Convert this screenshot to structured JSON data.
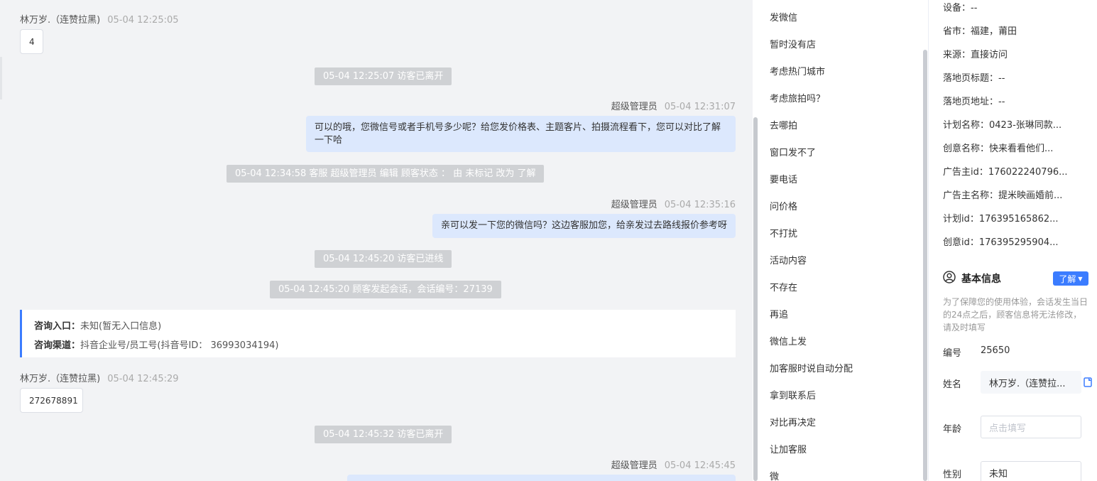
{
  "chat": {
    "messages": [
      {
        "sender": "林万岁.（连赞拉黑)",
        "time": "05-04 12:25:05",
        "text": "4"
      },
      {
        "system": "05-04 12:25:07 访客已离开"
      },
      {
        "sender": "超级管理员",
        "time": "05-04 12:31:07",
        "text": "可以的哦，您微信号或者手机号多少呢？给您发价格表、主题客片、拍摄流程看下，您可以对比了解一下哈"
      },
      {
        "system": "05-04 12:34:58 客服 超级管理员 编辑 顾客状态 ： 由 未标记 改为 了解"
      },
      {
        "sender": "超级管理员",
        "time": "05-04 12:35:16",
        "text": "亲可以发一下您的微信吗？这边客服加您，给亲发过去路线报价参考呀"
      },
      {
        "system": "05-04 12:45:20 访客已进线"
      },
      {
        "system": "05-04 12:45:20 顾客发起会话，会话编号：27139"
      },
      {
        "sender": "林万岁.（连赞拉黑)",
        "time": "05-04 12:45:29",
        "text": "272678891"
      },
      {
        "system": "05-04 12:45:32 访客已离开"
      },
      {
        "sender": "超级管理员",
        "time": "05-04 12:45:45"
      }
    ],
    "consult": {
      "entry_label": "咨询入口：",
      "entry_value": "未知(暂无入口信息)",
      "channel_label": "咨询渠道：",
      "channel_value": "抖音企业号/员工号(抖音号ID： 36993034194)"
    }
  },
  "quick_replies": [
    "发微信",
    "暂时没有店",
    "考虑热门城市",
    "考虑旅拍吗？",
    "去哪拍",
    "窗口发不了",
    "要电话",
    "问价格",
    "不打扰",
    "活动内容",
    "不存在",
    "再追",
    "微信上发",
    "加客服时说自动分配",
    "拿到联系后",
    "对比再决定",
    "让加客服",
    "微"
  ],
  "info": {
    "rows": [
      "设备：--",
      "省市：福建，莆田",
      "来源：直接访问",
      "落地页标题：--",
      "落地页地址：--",
      "计划名称：0423-张琳同款...",
      "创意名称：快来看看他们...",
      "广告主id：176022240796...",
      "广告主名称：提米映画婚前...",
      "计划id：176395165862...",
      "创意id：176395295904..."
    ],
    "basic_title": "基本信息",
    "learn_button": "了解",
    "note": "为了保障您的使用体验，会话发生当日的24点之后，顾客信息将无法修改，请及时填写",
    "id_label": "编号",
    "id_value": "25650",
    "name_label": "姓名",
    "name_value": "林万岁.（连赞拉...",
    "age_label": "年龄",
    "age_placeholder": "点击填写",
    "gender_label": "性别",
    "gender_value": "未知"
  },
  "colors": {
    "accent": "#3b7cff",
    "right_bubble": "#dce8fd",
    "system_pill": "#cfd1d4"
  }
}
